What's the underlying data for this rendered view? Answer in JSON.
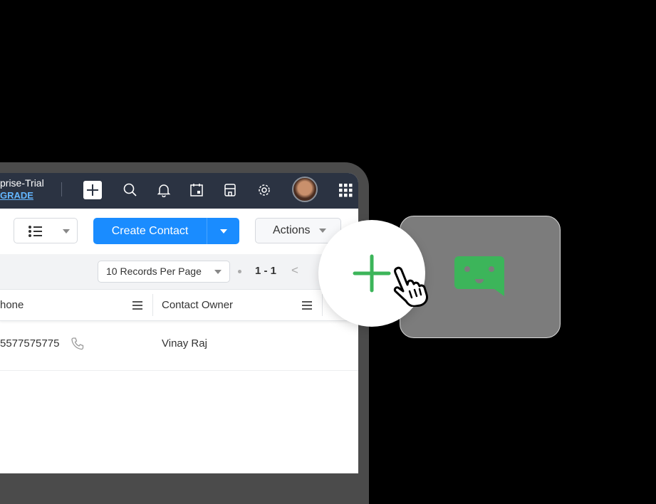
{
  "header": {
    "org_name": "prise-Trial",
    "upgrade_link": "GRADE",
    "icons": [
      "plus-icon",
      "search-icon",
      "bell-icon",
      "calendar-icon",
      "marketplace-icon",
      "gear-icon",
      "avatar",
      "app-grid-icon"
    ]
  },
  "toolbar": {
    "view_icon": "list-view-icon",
    "create_label": "Create Contact",
    "actions_label": "Actions"
  },
  "pager": {
    "per_page": "10 Records Per Page",
    "range": "1 - 1",
    "prev_symbol": "<"
  },
  "table": {
    "columns": [
      "hone",
      "Contact Owner"
    ],
    "rows": [
      {
        "phone": "5577575775",
        "owner": "Vinay Raj"
      }
    ]
  },
  "overlay": {
    "add_icon": "plus-icon",
    "cursor": "hand-pointer-icon",
    "widget_icon": "chat-bot-icon"
  },
  "colors": {
    "header_bg": "#2b3342",
    "primary": "#1a8cff",
    "accent_green": "#3cb55a",
    "widget_bg": "#7c7c7c"
  }
}
